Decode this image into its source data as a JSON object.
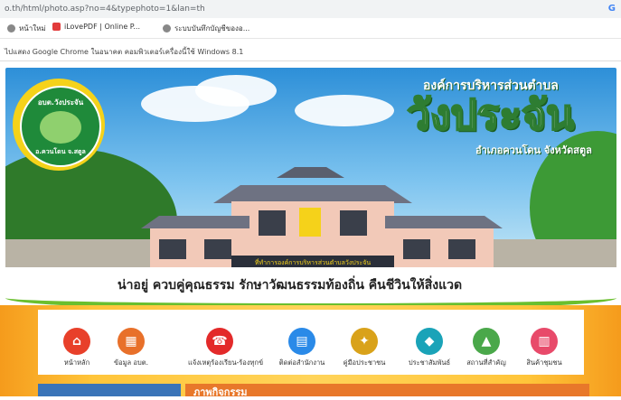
{
  "browser": {
    "url": "o.th/html/photo.asp?no=4&typephoto=1&lan=th",
    "bookmarks": [
      "หน้าใหม่",
      "iLovePDF | Online P...",
      "ระบบบันทึกบัญชีของอ..."
    ],
    "notice": "ไปแสดง Google Chrome ในอนาคต คอมพิวเตอร์เครื่องนี้ใช้ Windows 8.1"
  },
  "banner": {
    "org_small": "องค์การบริหารส่วนตำบล",
    "org_big": "วังประจัน",
    "org_district": "อำเภอควนโดน จังหวัดสตูล",
    "seal_top": "อบต.วังประจัน",
    "seal_bottom": "อ.ควนโดน จ.สตูล",
    "building_sign": "ที่ทำการองค์การบริหารส่วนตำบลวังประจัน"
  },
  "motto": "น่าอยู่ ควบคู่คุณธรรม รักษาวัฒนธรรมท้องถิ่น คืนชีวินให้สิ่งแวด",
  "nav": [
    {
      "label": "หน้าหลัก",
      "icon": "home-icon",
      "color": "#e8402a"
    },
    {
      "label": "ข้อมูล อบต.",
      "icon": "building-icon",
      "color": "#e8702a"
    },
    {
      "label": "แจ้งเหตุร้องเรียน-ร้องทุกข์",
      "icon": "phone-icon",
      "color": "#e32a2a"
    },
    {
      "label": "ติดต่อสำนักงาน",
      "icon": "office-icon",
      "color": "#2a8ae8"
    },
    {
      "label": "คู่มือประชาชน",
      "icon": "book-icon",
      "color": "#d9a21a"
    },
    {
      "label": "ประชาสัมพันธ์",
      "icon": "megaphone-icon",
      "color": "#1aa3b8"
    },
    {
      "label": "สถานที่สำคัญ",
      "icon": "landscape-icon",
      "color": "#4aa84a"
    },
    {
      "label": "สินค้าชุมชน",
      "icon": "shop-icon",
      "color": "#e84a6a"
    }
  ],
  "section": {
    "activity_title": "ภาพกิจกรรม"
  }
}
